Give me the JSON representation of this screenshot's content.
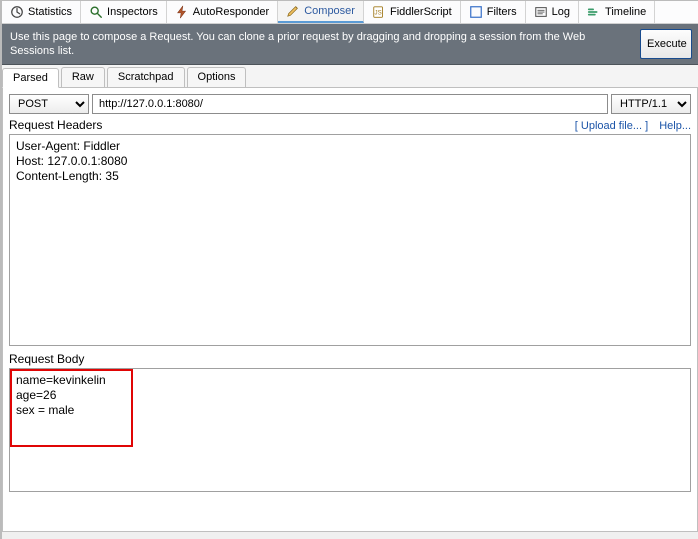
{
  "topTabs": [
    {
      "label": "Statistics",
      "icon": "clock"
    },
    {
      "label": "Inspectors",
      "icon": "magnifier"
    },
    {
      "label": "AutoResponder",
      "icon": "bolt"
    },
    {
      "label": "Composer",
      "icon": "pencil",
      "active": true
    },
    {
      "label": "FiddlerScript",
      "icon": "script"
    },
    {
      "label": "Filters",
      "icon": "filter"
    },
    {
      "label": "Log",
      "icon": "log"
    },
    {
      "label": "Timeline",
      "icon": "timeline"
    }
  ],
  "infoBar": {
    "text": "Use this page to compose a Request. You can clone a prior request by dragging and dropping a session from the Web Sessions list.",
    "executeLabel": "Execute"
  },
  "subTabs": [
    {
      "label": "Parsed",
      "active": true
    },
    {
      "label": "Raw"
    },
    {
      "label": "Scratchpad"
    },
    {
      "label": "Options"
    }
  ],
  "request": {
    "method": "POST",
    "url": "http://127.0.0.1:8080/",
    "protocol": "HTTP/1.1"
  },
  "headersSection": {
    "title": "Request Headers",
    "uploadLink": "[ Upload file... ]",
    "helpLink": "Help...",
    "content": "User-Agent: Fiddler\nHost: 127.0.0.1:8080\nContent-Length: 35"
  },
  "bodySection": {
    "title": "Request Body",
    "content": "name=kevinkelin\nage=26\nsex = male"
  }
}
